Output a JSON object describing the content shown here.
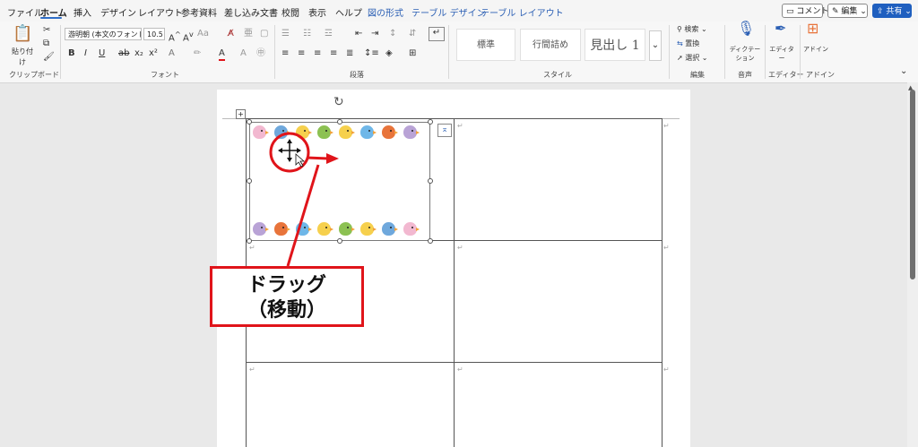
{
  "menu": {
    "tabs": [
      "ファイル",
      "ホーム",
      "挿入",
      "デザイン",
      "レイアウト",
      "参考資料",
      "差し込み文書",
      "校閲",
      "表示",
      "ヘルプ"
    ],
    "context_tabs": [
      "図の形式",
      "テーブル デザイン",
      "テーブル レイアウト"
    ],
    "comment_label": "コメント",
    "edit_label": "編集",
    "share_label": "共有"
  },
  "ribbon": {
    "paste_label": "貼り付け",
    "font_name": "游明朝 (本文のフォント",
    "font_size": "10.5",
    "styles": [
      "標準",
      "行間詰め",
      "見出し 1"
    ],
    "search_label": "検索",
    "replace_label": "置換",
    "select_label": "選択",
    "dictate_label": "ディクテーション",
    "editor_label": "エディター",
    "addin_label": "アドイン",
    "groups": {
      "clipboard": "クリップボード",
      "font": "フォント",
      "paragraph": "段落",
      "style": "スタイル",
      "edit": "編集",
      "voice": "音声",
      "editor": "エディター",
      "addin": "アドイン"
    }
  },
  "annotation": {
    "line1": "ドラッグ",
    "line2": "（移動）",
    "accent": "#e0141a"
  },
  "document": {
    "paragraph_mark": "↵"
  },
  "colors": {
    "share": "#1f5fbf",
    "context_tab": "#2b5fb4",
    "birds": [
      "#f2b8d0",
      "#6fa8dc",
      "#f6d04d",
      "#8cc152",
      "#f6d04d",
      "#6fb7e8",
      "#e8743b",
      "#b9a3d6"
    ],
    "birds_bottom": [
      "#b9a3d6",
      "#e8743b",
      "#6fb7e8",
      "#f6d04d",
      "#8cc152",
      "#f6d04d",
      "#6fa8dc",
      "#f2b8d0"
    ]
  }
}
